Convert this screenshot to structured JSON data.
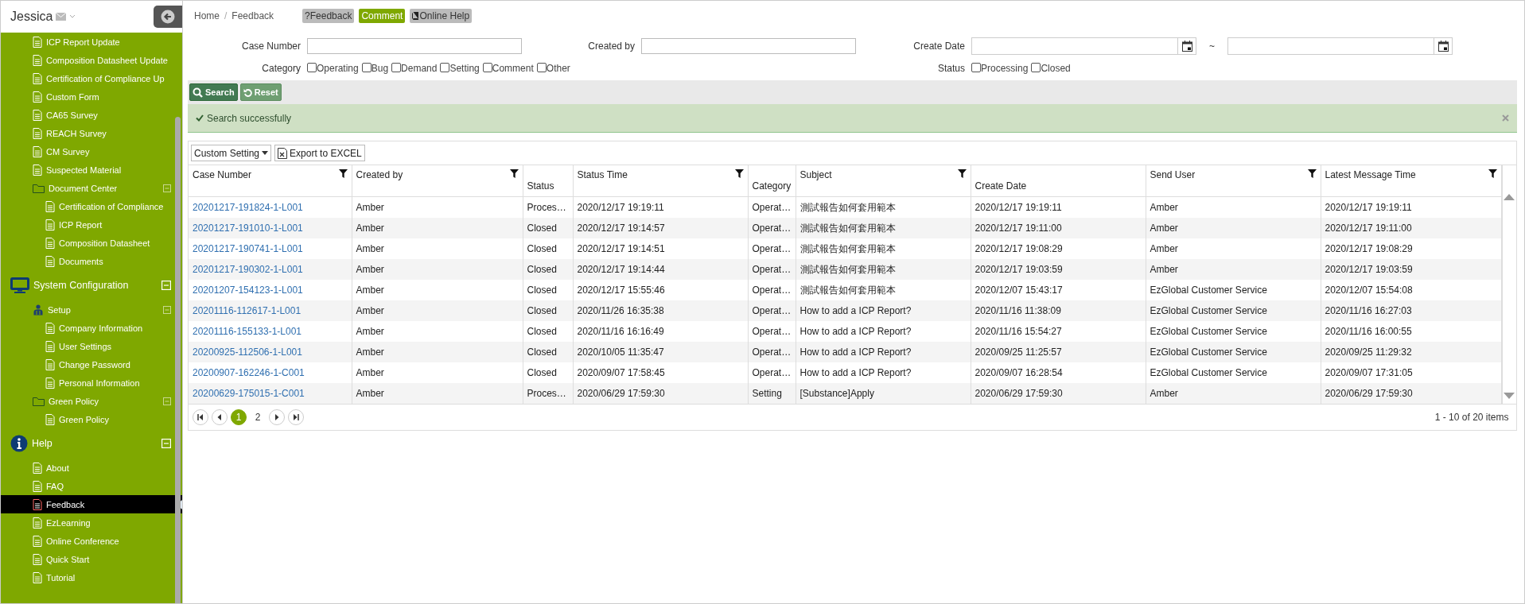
{
  "user": {
    "name": "Jessica"
  },
  "sidebar": {
    "items": [
      {
        "label": "ICP Report Update",
        "kind": "page",
        "selected": false
      },
      {
        "label": "Composition Datasheet Update",
        "kind": "page",
        "selected": false
      },
      {
        "label": "Certification of Compliance Up",
        "kind": "page",
        "selected": false
      },
      {
        "label": "Custom Form",
        "kind": "page",
        "selected": false
      },
      {
        "label": "CA65 Survey",
        "kind": "page",
        "selected": false
      },
      {
        "label": "REACH Survey",
        "kind": "page",
        "selected": false
      },
      {
        "label": "CM Survey",
        "kind": "page",
        "selected": false
      },
      {
        "label": "Suspected Material",
        "kind": "page",
        "selected": false
      },
      {
        "label": "Document Center",
        "kind": "folder",
        "selected": false,
        "expanded": true,
        "children": [
          {
            "label": "Certification of Compliance",
            "kind": "page",
            "selected": false
          },
          {
            "label": "ICP Report",
            "kind": "page",
            "selected": false
          },
          {
            "label": "Composition Datasheet",
            "kind": "page",
            "selected": false
          },
          {
            "label": "Documents",
            "kind": "page",
            "selected": false
          }
        ]
      },
      {
        "label": "System Configuration",
        "kind": "section",
        "selected": false,
        "expanded": true,
        "children": [
          {
            "label": "Setup",
            "kind": "group",
            "selected": false,
            "expanded": true,
            "children": [
              {
                "label": "Company Information",
                "kind": "page",
                "selected": false
              },
              {
                "label": "User Settings",
                "kind": "page",
                "selected": false
              },
              {
                "label": "Change Password",
                "kind": "page",
                "selected": false
              },
              {
                "label": "Personal Information",
                "kind": "page",
                "selected": false
              }
            ]
          },
          {
            "label": "Green Policy",
            "kind": "folder",
            "selected": false,
            "expanded": true,
            "children": [
              {
                "label": "Green Policy",
                "kind": "page",
                "selected": false
              }
            ]
          }
        ]
      },
      {
        "label": "Help",
        "kind": "section",
        "selected": false,
        "expanded": true,
        "children": [
          {
            "label": "About",
            "kind": "page",
            "selected": false
          },
          {
            "label": "FAQ",
            "kind": "page",
            "selected": false
          },
          {
            "label": "Feedback",
            "kind": "page",
            "selected": true
          },
          {
            "label": "EzLearning",
            "kind": "page",
            "selected": false
          },
          {
            "label": "Online Conference",
            "kind": "page",
            "selected": false
          },
          {
            "label": "Quick Start",
            "kind": "page",
            "selected": false
          },
          {
            "label": "Tutorial",
            "kind": "page",
            "selected": false
          }
        ]
      }
    ]
  },
  "breadcrumb": {
    "items": [
      "Home",
      "Feedback"
    ],
    "separator": "/"
  },
  "header_buttons": [
    {
      "label": "?Feedback",
      "kind": "plain",
      "selected": false
    },
    {
      "label": "Comment",
      "kind": "plain",
      "selected": true
    },
    {
      "label": "Online Help",
      "kind": "book",
      "selected": false
    }
  ],
  "form": {
    "fields": [
      {
        "kind": "text",
        "label": "Case Number"
      },
      {
        "kind": "text",
        "label": "Created by"
      },
      {
        "kind": "daterange",
        "label": "Create Date",
        "separator": "~"
      }
    ],
    "checkgroups": [
      {
        "label": "Category",
        "options": [
          {
            "label": "Operating",
            "checked": false
          },
          {
            "label": "Bug",
            "checked": false
          },
          {
            "label": "Demand",
            "checked": false
          },
          {
            "label": "Setting",
            "checked": false
          },
          {
            "label": "Comment",
            "checked": false
          },
          {
            "label": "Other",
            "checked": false
          }
        ]
      },
      {
        "label": "Status",
        "options": [
          {
            "label": "Processing",
            "checked": false
          },
          {
            "label": "Closed",
            "checked": false
          }
        ]
      }
    ]
  },
  "actions": [
    {
      "label": "Search",
      "kind": "search"
    },
    {
      "label": "Reset",
      "kind": "reset"
    }
  ],
  "alert": {
    "message": "Search successfully"
  },
  "grid": {
    "toolbar": {
      "custom_setting": "Custom Setting",
      "export": "Export to EXCEL"
    },
    "columns": [
      {
        "label": "Case Number",
        "filterable": true
      },
      {
        "label": "Created by",
        "filterable": true
      },
      {
        "label": "Status",
        "filterable": false
      },
      {
        "label": "Status Time",
        "filterable": true
      },
      {
        "label": "Category",
        "filterable": false
      },
      {
        "label": "Subject",
        "filterable": true
      },
      {
        "label": "Create Date",
        "filterable": false
      },
      {
        "label": "Send User",
        "filterable": true
      },
      {
        "label": "Latest Message Time",
        "filterable": true
      }
    ],
    "rows": [
      [
        "20201217-191824-1-L001",
        "Amber",
        "Proces…",
        "2020/12/17 19:19:11",
        "Operat…",
        "測試報告如何套用範本",
        "2020/12/17 19:19:11",
        "Amber",
        "2020/12/17 19:19:11"
      ],
      [
        "20201217-191010-1-L001",
        "Amber",
        "Closed",
        "2020/12/17 19:14:57",
        "Operat…",
        "測試報告如何套用範本",
        "2020/12/17 19:11:00",
        "Amber",
        "2020/12/17 19:11:00"
      ],
      [
        "20201217-190741-1-L001",
        "Amber",
        "Closed",
        "2020/12/17 19:14:51",
        "Operat…",
        "測試報告如何套用範本",
        "2020/12/17 19:08:29",
        "Amber",
        "2020/12/17 19:08:29"
      ],
      [
        "20201217-190302-1-L001",
        "Amber",
        "Closed",
        "2020/12/17 19:14:44",
        "Operat…",
        "測試報告如何套用範本",
        "2020/12/17 19:03:59",
        "Amber",
        "2020/12/17 19:03:59"
      ],
      [
        "20201207-154123-1-L001",
        "Amber",
        "Closed",
        "2020/12/17 15:55:46",
        "Operat…",
        "測試報告如何套用範本",
        "2020/12/07 15:43:17",
        "EzGlobal Customer Service",
        "2020/12/07 15:54:08"
      ],
      [
        "20201116-112617-1-L001",
        "Amber",
        "Closed",
        "2020/11/26 16:35:38",
        "Operat…",
        "How to add a ICP Report?",
        "2020/11/16 11:38:09",
        "EzGlobal Customer Service",
        "2020/11/16 16:27:03"
      ],
      [
        "20201116-155133-1-L001",
        "Amber",
        "Closed",
        "2020/11/16 16:16:49",
        "Operat…",
        "How to add a ICP Report?",
        "2020/11/16 15:54:27",
        "EzGlobal Customer Service",
        "2020/11/16 16:00:55"
      ],
      [
        "20200925-112506-1-L001",
        "Amber",
        "Closed",
        "2020/10/05 11:35:47",
        "Operat…",
        "How to add a ICP Report?",
        "2020/09/25 11:25:57",
        "EzGlobal Customer Service",
        "2020/09/25 11:29:32"
      ],
      [
        "20200907-162246-1-C001",
        "Amber",
        "Closed",
        "2020/09/07 17:58:45",
        "Operat…",
        "How to add a ICP Report?",
        "2020/09/07 16:28:54",
        "EzGlobal Customer Service",
        "2020/09/07 17:31:05"
      ],
      [
        "20200629-175015-1-C001",
        "Amber",
        "Proces…",
        "2020/06/29 17:59:30",
        "Setting",
        "[Substance]Apply",
        "2020/06/29 17:59:30",
        "Amber",
        "2020/06/29 17:59:30"
      ]
    ],
    "pager": {
      "pages": [
        {
          "label": "1",
          "selected": true
        },
        {
          "label": "2",
          "selected": false
        }
      ],
      "summary": "1 - 10 of 20 items"
    }
  }
}
